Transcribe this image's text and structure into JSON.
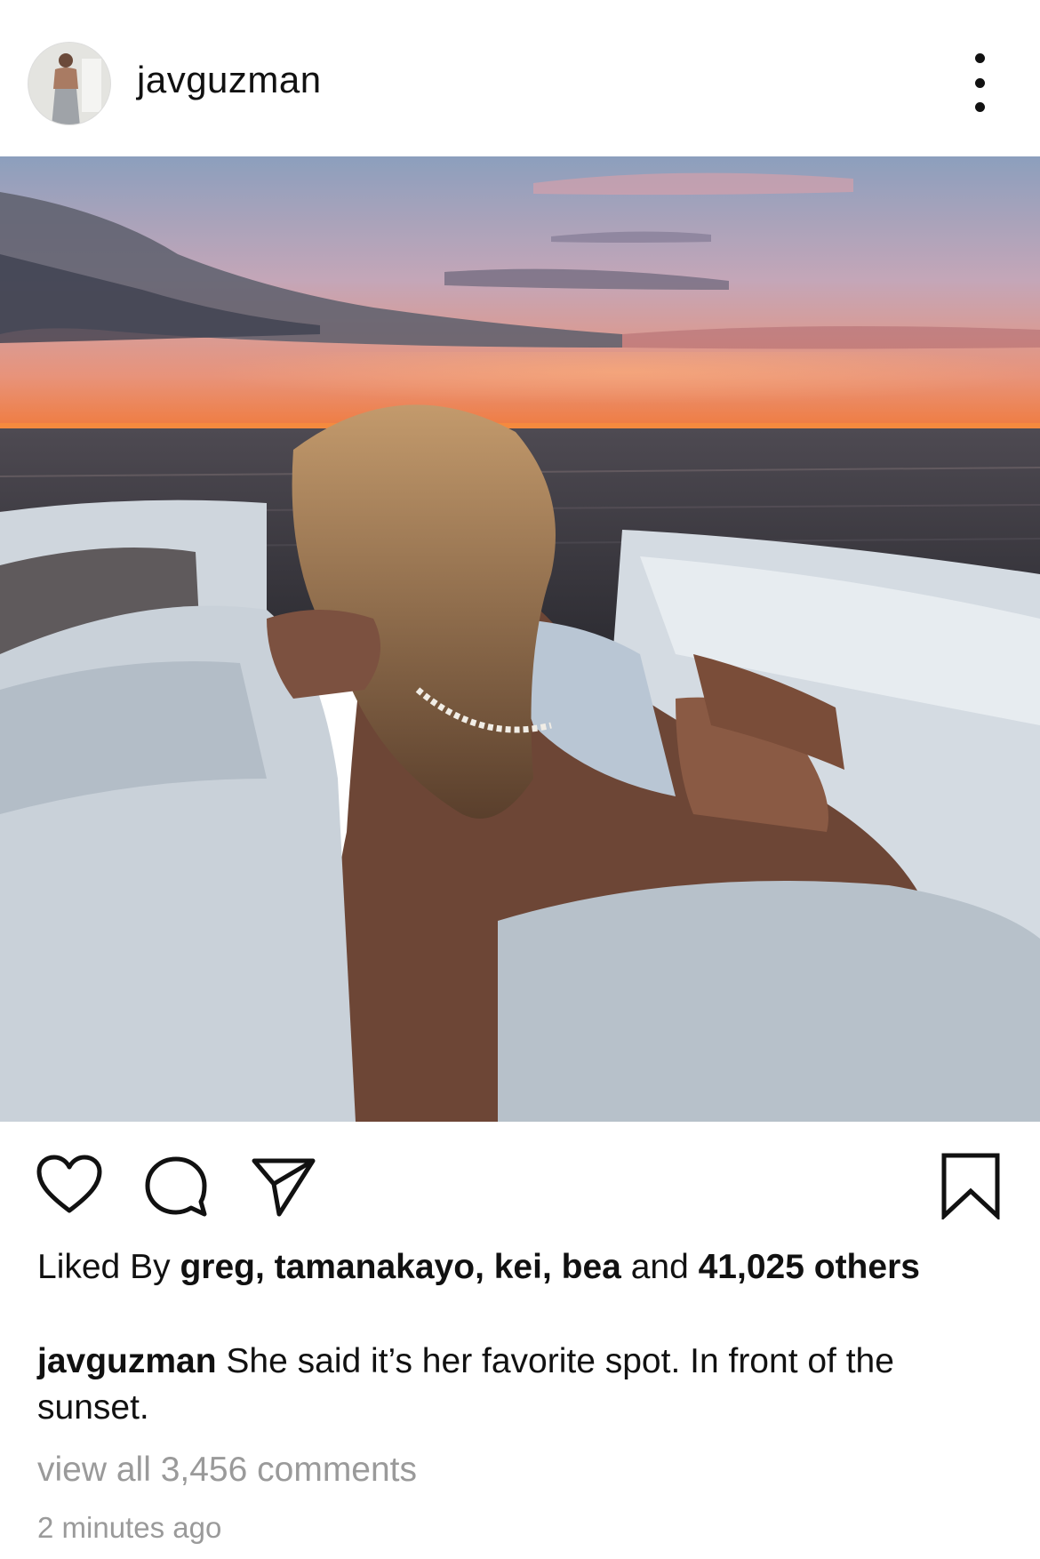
{
  "header": {
    "username": "javguzman",
    "more_icon": "more-vertical-icon"
  },
  "post": {
    "photo_subject": "sunset-boat-photo"
  },
  "actions": {
    "like_icon": "heart-icon",
    "comment_icon": "comment-icon",
    "share_icon": "send-icon",
    "save_icon": "bookmark-icon"
  },
  "likes": {
    "prefix": "Liked By",
    "names": "greg, tamanakayo, kei, bea",
    "joiner": "and",
    "count": "41,025",
    "suffix": "others"
  },
  "caption": {
    "username": "javguzman",
    "text": "She said it’s her favorite spot. In front of the sunset."
  },
  "comments": {
    "view_all": "view all 3,456 comments"
  },
  "timestamp": "2 minutes ago",
  "colors": {
    "text": "#111111",
    "muted": "#9a9a9a",
    "background": "#ffffff"
  }
}
